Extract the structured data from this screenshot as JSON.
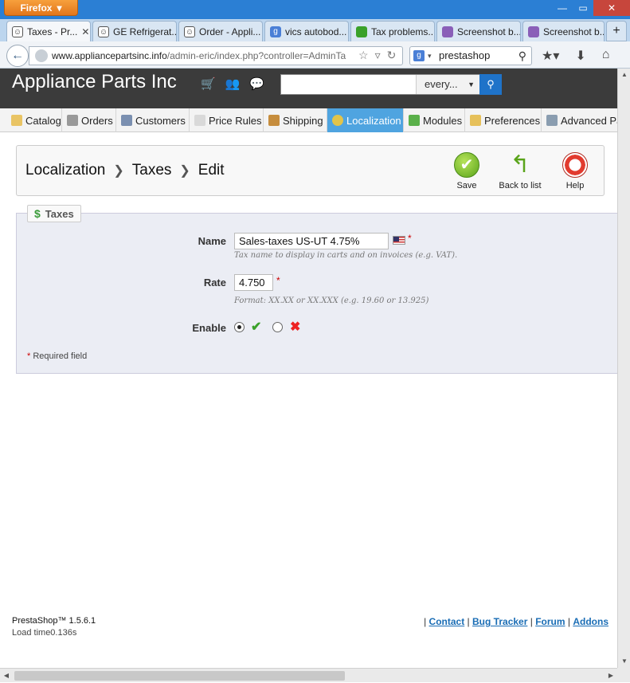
{
  "browser": {
    "app_button": "Firefox",
    "tabs": [
      {
        "label": "Taxes - Pr...",
        "icon": "prestashop-icon",
        "active": true
      },
      {
        "label": "GE Refrigerat...",
        "icon": "prestashop-icon"
      },
      {
        "label": "Order - Appli...",
        "icon": "prestashop-icon"
      },
      {
        "label": "vics autobod...",
        "icon": "google-icon"
      },
      {
        "label": "Tax problems...",
        "icon": "leaf-icon"
      },
      {
        "label": "Screenshot b...",
        "icon": "feather-icon"
      },
      {
        "label": "Screenshot b...",
        "icon": "feather-icon"
      }
    ],
    "url_host": "www.appliancepartsinc.info",
    "url_path": "/admin-eric/index.php?controller=AdminTa",
    "search_value": "prestashop"
  },
  "header": {
    "shop_name": "Appliance Parts Inc",
    "search_placeholder": "",
    "search_scope": "every..."
  },
  "menu": [
    {
      "label": "Catalog",
      "icon": "folder-icon"
    },
    {
      "label": "Orders",
      "icon": "cart-icon"
    },
    {
      "label": "Customers",
      "icon": "customer-icon"
    },
    {
      "label": "Price Rules",
      "icon": "price-tag-icon"
    },
    {
      "label": "Shipping",
      "icon": "truck-icon"
    },
    {
      "label": "Localization",
      "icon": "globe-icon",
      "active": true
    },
    {
      "label": "Modules",
      "icon": "puzzle-icon"
    },
    {
      "label": "Preferences",
      "icon": "pencil-icon"
    },
    {
      "label": "Advanced Pa",
      "icon": "wrench-icon"
    }
  ],
  "toolbar": {
    "breadcrumb": [
      "Localization",
      "Taxes",
      "Edit"
    ],
    "save_label": "Save",
    "back_label": "Back to list",
    "help_label": "Help"
  },
  "form": {
    "legend": "Taxes",
    "name_label": "Name",
    "name_value": "Sales-taxes US-UT 4.75%",
    "name_hint": "Tax name to display in carts and on invoices (e.g. VAT).",
    "rate_label": "Rate",
    "rate_value": "4.750",
    "rate_hint": "Format: XX.XX or XX.XXX (e.g. 19.60 or 13.925)",
    "enable_label": "Enable",
    "enable_yes": true,
    "required_star": "*",
    "required_note": "Required field"
  },
  "footer": {
    "version": "PrestaShop™ 1.5.6.1",
    "load_time": "Load time0.136s",
    "links": [
      "Contact",
      "Bug Tracker",
      "Forum",
      "Addons"
    ]
  },
  "colors": {
    "active_menu": "#4fa4e0",
    "header_bg": "#3b3b3b",
    "form_bg": "#ebedf4"
  }
}
